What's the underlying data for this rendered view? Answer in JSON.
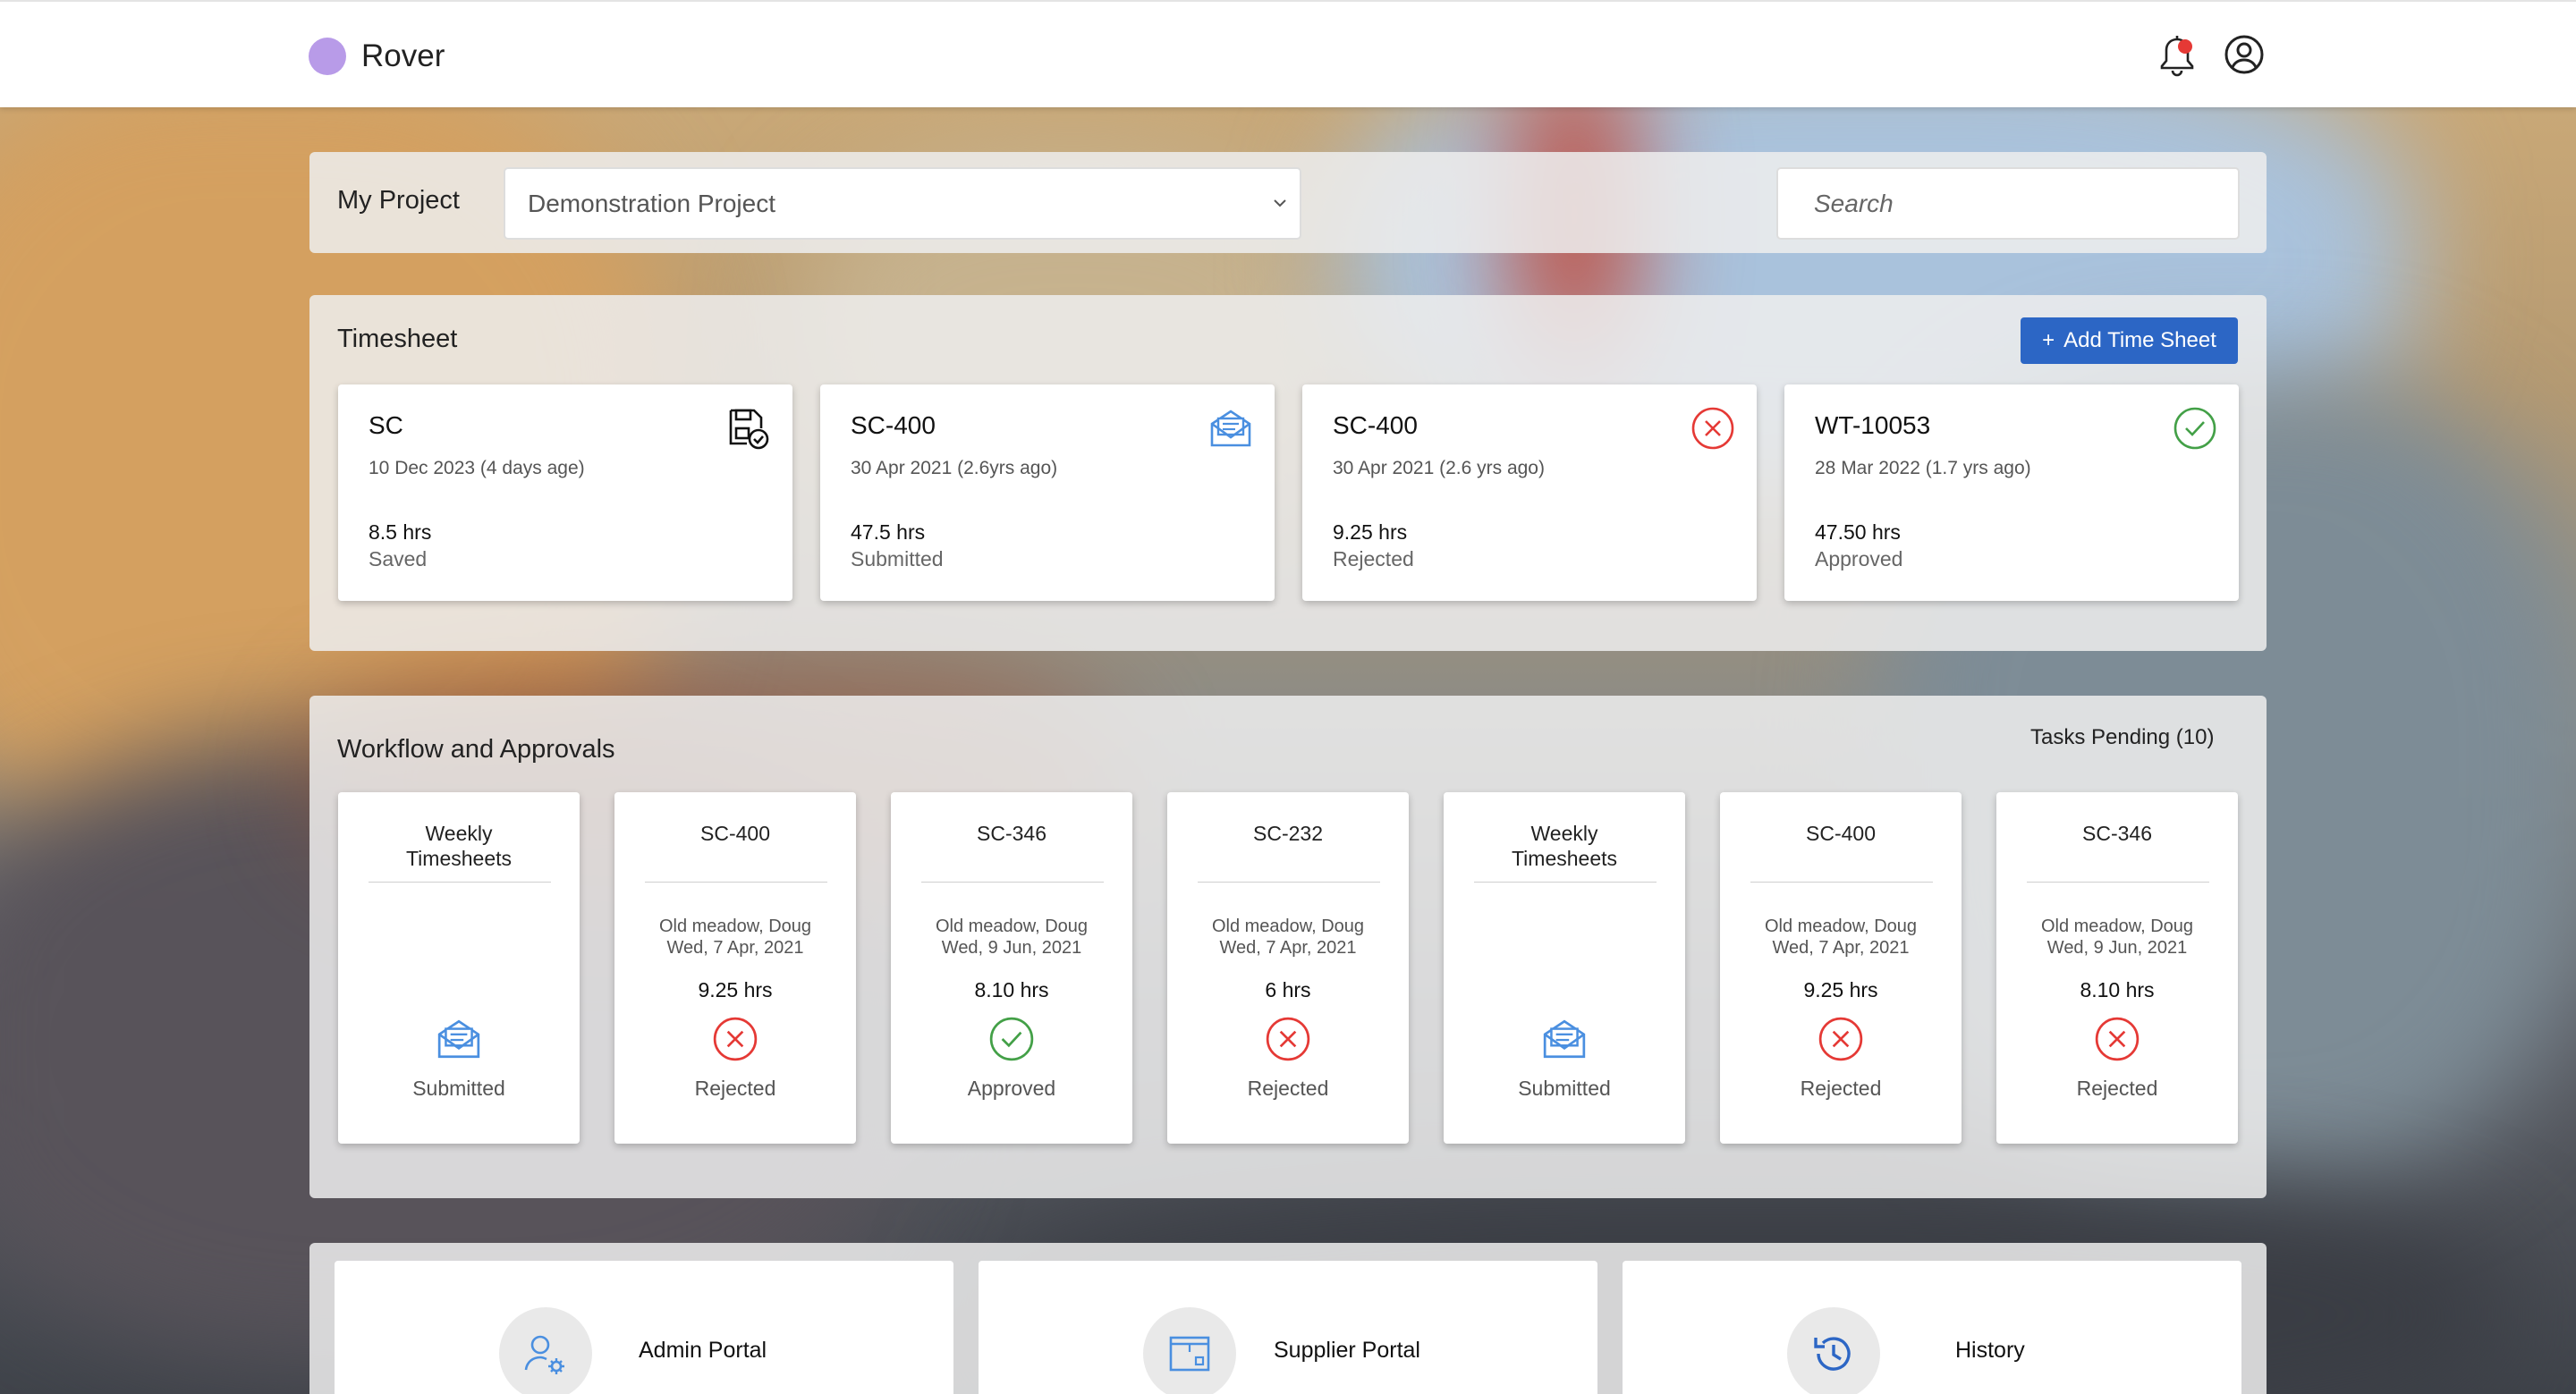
{
  "app": {
    "name": "Rover",
    "logo_color": "#b89be8"
  },
  "header": {
    "icons": [
      "bell-icon",
      "user-circle-icon"
    ],
    "notification_dot_color": "#e53935"
  },
  "project": {
    "label": "My Project",
    "selected": "Demonstration Project",
    "search_placeholder": "Search"
  },
  "timesheet": {
    "title": "Timesheet",
    "add_button": "Add Time Sheet",
    "cards": [
      {
        "code": "SC",
        "date": "10 Dec 2023 (4 days age)",
        "hours": "8.5 hrs",
        "status": "Saved",
        "icon": "save-check-icon"
      },
      {
        "code": "SC-400",
        "date": "30 Apr 2021 (2.6yrs ago)",
        "hours": "47.5 hrs",
        "status": "Submitted",
        "icon": "envelope-open-icon"
      },
      {
        "code": "SC-400",
        "date": "30 Apr 2021 (2.6 yrs ago)",
        "hours": "9.25 hrs",
        "status": "Rejected",
        "icon": "x-circle-icon"
      },
      {
        "code": "WT-10053",
        "date": "28 Mar 2022 (1.7 yrs ago)",
        "hours": "47.50 hrs",
        "status": "Approved",
        "icon": "check-circle-icon"
      }
    ]
  },
  "workflow": {
    "title": "Workflow and Approvals",
    "tasks_pending": "Tasks Pending (10)",
    "cards": [
      {
        "title": "Weekly Timesheets",
        "person": "",
        "date": "",
        "hours": "",
        "status": "Submitted",
        "icon": "envelope-open-icon"
      },
      {
        "title": "SC-400",
        "person": "Old meadow, Doug",
        "date": "Wed, 7 Apr, 2021",
        "hours": "9.25 hrs",
        "status": "Rejected",
        "icon": "x-circle-icon"
      },
      {
        "title": "SC-346",
        "person": "Old meadow, Doug",
        "date": "Wed, 9 Jun, 2021",
        "hours": "8.10 hrs",
        "status": "Approved",
        "icon": "check-circle-icon"
      },
      {
        "title": "SC-232",
        "person": "Old meadow, Doug",
        "date": "Wed, 7 Apr, 2021",
        "hours": "6 hrs",
        "status": "Rejected",
        "icon": "x-circle-icon"
      },
      {
        "title": "Weekly Timesheets",
        "person": "",
        "date": "",
        "hours": "",
        "status": "Submitted",
        "icon": "envelope-open-icon"
      },
      {
        "title": "SC-400",
        "person": "Old meadow, Doug",
        "date": "Wed, 7 Apr, 2021",
        "hours": "9.25 hrs",
        "status": "Rejected",
        "icon": "x-circle-icon"
      },
      {
        "title": "SC-346",
        "person": "Old meadow, Doug",
        "date": "Wed, 9 Jun, 2021",
        "hours": "8.10 hrs",
        "status": "Rejected",
        "icon": "x-circle-icon"
      }
    ]
  },
  "portals": [
    {
      "label": "Admin Portal",
      "icon": "user-gear-icon"
    },
    {
      "label": "Supplier Portal",
      "icon": "box-icon"
    },
    {
      "label": "History",
      "icon": "history-icon"
    }
  ],
  "colors": {
    "primary": "#2c66c5",
    "rejected": "#e53935",
    "approved": "#43a047",
    "submitted": "#4a8fe0"
  }
}
